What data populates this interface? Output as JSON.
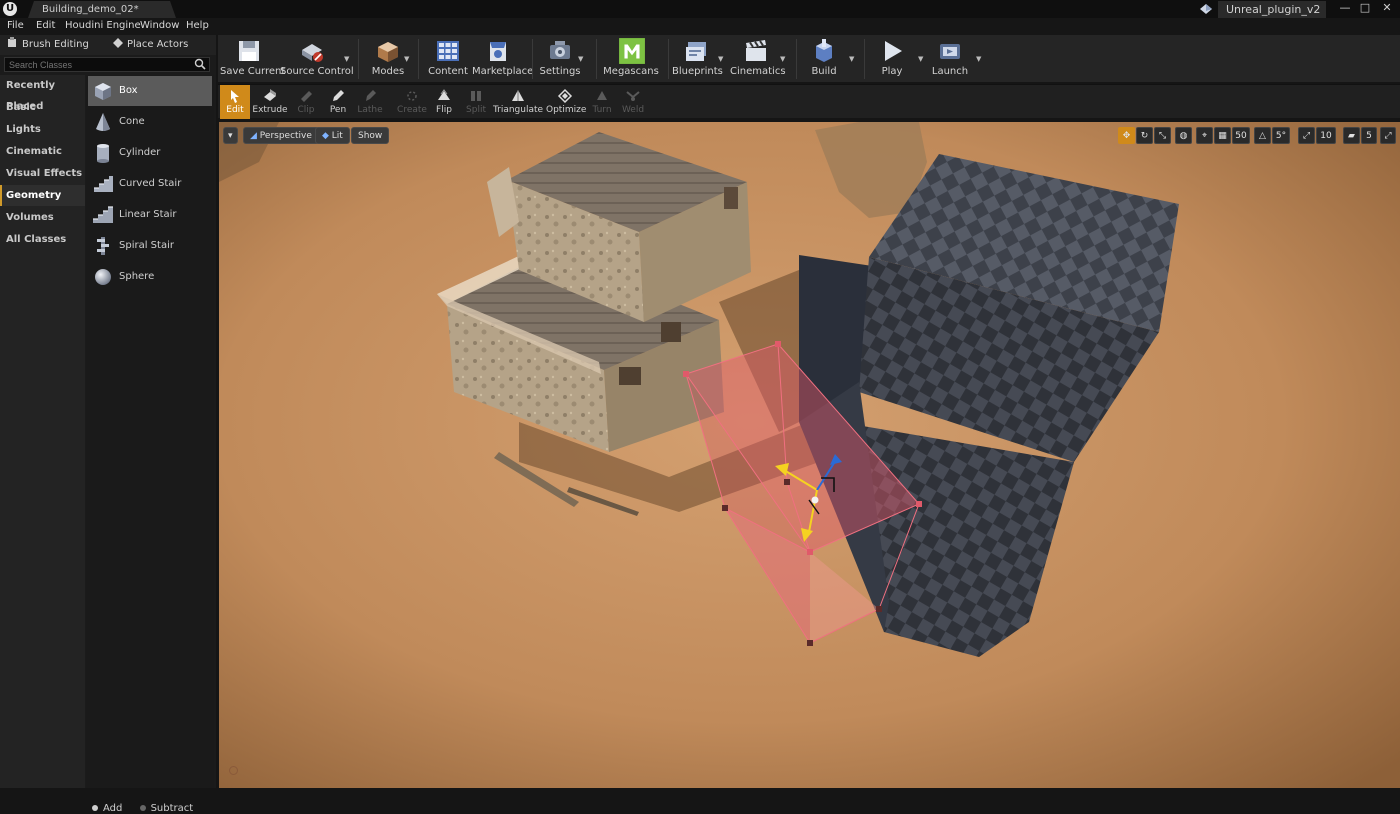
{
  "titlebar": {
    "document_tab": "Building_demo_02*",
    "project_name": "Unreal_plugin_v2",
    "logo": "U"
  },
  "menu": [
    "File",
    "Edit",
    "Houdini Engine",
    "Window",
    "Help"
  ],
  "mode_tabs": {
    "brush_editing": "Brush Editing",
    "place_actors": "Place Actors"
  },
  "search": {
    "placeholder": "Search Classes"
  },
  "categories": [
    "Recently Placed",
    "Basic",
    "Lights",
    "Cinematic",
    "Visual Effects",
    "Geometry",
    "Volumes",
    "All Classes"
  ],
  "active_category": "Geometry",
  "classes": [
    "Box",
    "Cone",
    "Cylinder",
    "Curved Stair",
    "Linear Stair",
    "Spiral Stair",
    "Sphere"
  ],
  "brush_type": {
    "add": "Add",
    "subtract": "Subtract"
  },
  "toolbar": [
    "Save Current",
    "Source Control",
    "Modes",
    "Content",
    "Marketplace",
    "Settings",
    "Megascans",
    "Blueprints",
    "Cinematics",
    "Build",
    "Play",
    "Launch"
  ],
  "geometry_tools": [
    "Edit",
    "Extrude",
    "Clip",
    "Pen",
    "Lathe",
    "Create",
    "Flip",
    "Split",
    "Triangulate",
    "Optimize",
    "Turn",
    "Weld"
  ],
  "viewport": {
    "perspective": "Perspective",
    "lit": "Lit",
    "show": "Show",
    "grid_snap": "50",
    "rotation_snap": "5°",
    "scale_snap": "10",
    "camera_speed": "5"
  },
  "colors": {
    "accent": "#d08a1a",
    "panel": "#1b1b1b",
    "brush_selection": "#e05a6a"
  }
}
